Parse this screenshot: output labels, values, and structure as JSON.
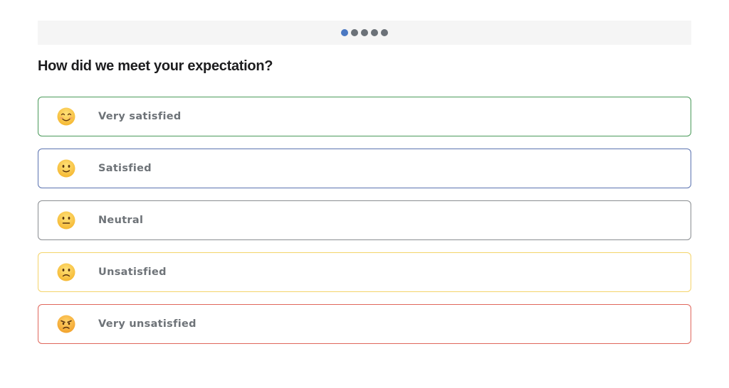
{
  "progress": {
    "total_steps": 5,
    "current_step": 1,
    "active_color": "#4a78c2",
    "inactive_color": "#6b7178"
  },
  "question": {
    "text": "How did we meet your expectation?"
  },
  "options": [
    {
      "label": "Very satisfied",
      "icon": "smiling-face-icon",
      "border_color": "#4a9a5a"
    },
    {
      "label": "Satisfied",
      "icon": "slightly-smiling-face-icon",
      "border_color": "#5b73b0"
    },
    {
      "label": "Neutral",
      "icon": "neutral-face-icon",
      "border_color": "#8a8d91"
    },
    {
      "label": "Unsatisfied",
      "icon": "slightly-frowning-face-icon",
      "border_color": "#f4d46a"
    },
    {
      "label": "Very unsatisfied",
      "icon": "angry-face-icon",
      "border_color": "#e0675c"
    }
  ]
}
